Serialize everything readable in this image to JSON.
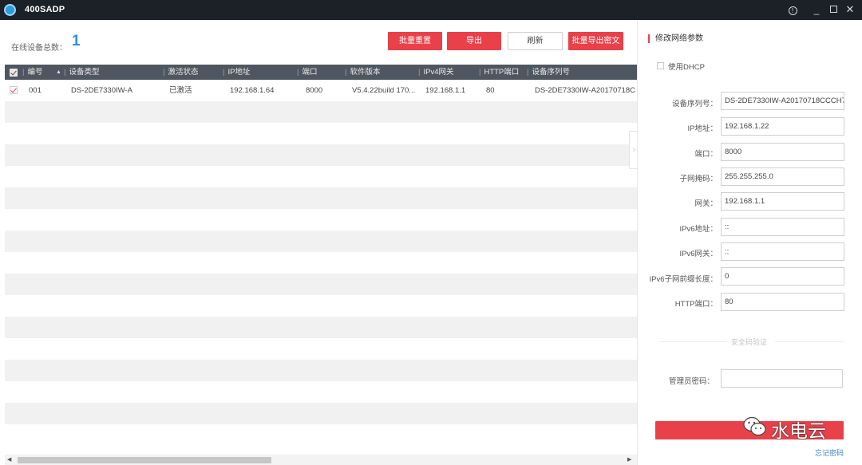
{
  "titlebar": {
    "app_title": "400SADP",
    "logo_icon": "sadp-logo-icon",
    "help_icon": "help-icon",
    "minimize_icon": "minimize-icon",
    "maximize_icon": "maximize-icon",
    "close_icon": "close-icon"
  },
  "summary": {
    "online_count_label": "在线设备总数：",
    "online_count_value": "1"
  },
  "toolbar": {
    "batch_reset_label": "批量重置",
    "export_label": "导出",
    "refresh_label": "刷新",
    "batch_export_ciphertext_label": "批量导出密文"
  },
  "table": {
    "columns": [
      "编号",
      "设备类型",
      "激活状态",
      "IP地址",
      "端口",
      "软件版本",
      "IPv4网关",
      "HTTP端口",
      "设备序列号"
    ],
    "rows": [
      {
        "checked": true,
        "cells": [
          "001",
          "DS-2DE7330IW-A",
          "已激活",
          "192.168.1.64",
          "8000",
          "V5.4.22build 170...",
          "192.168.1.1",
          "80",
          "DS-2DE7330IW-A20170718C"
        ]
      }
    ]
  },
  "panel": {
    "title": "修改网络参数",
    "dhcp_label": "使用DHCP",
    "fields": [
      {
        "label": "设备序列号：",
        "value": "DS-2DE7330IW-A20170718CCCH7"
      },
      {
        "label": "IP地址：",
        "value": "192.168.1.22"
      },
      {
        "label": "端口：",
        "value": "8000"
      },
      {
        "label": "子网掩码：",
        "value": "255.255.255.0"
      },
      {
        "label": "网关：",
        "value": "192.168.1.1"
      },
      {
        "label": "IPv6地址：",
        "value": "::"
      },
      {
        "label": "IPv6网关：",
        "value": "::"
      },
      {
        "label": "IPv6子网前缀长度：",
        "value": "0"
      },
      {
        "label": "HTTP端口：",
        "value": "80"
      }
    ],
    "security_divider": "安全码验证",
    "admin_password_label": "管理员密码：",
    "admin_password_value": "",
    "forgot_password_link": "忘记密码"
  },
  "watermark": {
    "text": "水电云",
    "icon": "wechat-icon"
  },
  "colors": {
    "titlebar_bg": "#1c2128",
    "accent_red": "#e9414a",
    "table_header_bg": "#4e5760",
    "count_blue": "#2f8fd8",
    "link_blue": "#3a84c9"
  }
}
